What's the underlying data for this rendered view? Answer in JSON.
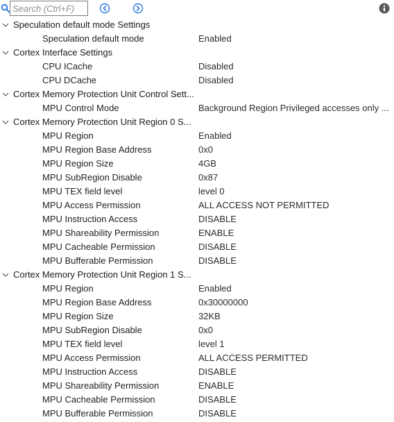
{
  "toolbar": {
    "search_placeholder": "Search (Ctrl+F)",
    "search_icon": "magnifier-icon",
    "back_icon": "circle-chevron-left-icon",
    "forward_icon": "circle-chevron-right-icon",
    "info_icon": "info-icon",
    "accent_color": "#2b78e4"
  },
  "groups": [
    {
      "label": "Speculation default mode Settings",
      "params": [
        {
          "label": "Speculation default mode",
          "value": "Enabled"
        }
      ]
    },
    {
      "label": "Cortex Interface Settings",
      "params": [
        {
          "label": "CPU ICache",
          "value": "Disabled"
        },
        {
          "label": "CPU DCache",
          "value": "Disabled"
        }
      ]
    },
    {
      "label": "Cortex Memory Protection Unit Control Sett...",
      "params": [
        {
          "label": "MPU Control Mode",
          "value": "Background Region Privileged accesses only ..."
        }
      ]
    },
    {
      "label": "Cortex Memory Protection Unit Region 0 S...",
      "params": [
        {
          "label": "MPU Region",
          "value": "Enabled"
        },
        {
          "label": "MPU Region Base Address",
          "value": "0x0"
        },
        {
          "label": "MPU Region Size",
          "value": "4GB"
        },
        {
          "label": "MPU SubRegion Disable",
          "value": "0x87"
        },
        {
          "label": "MPU TEX field level",
          "value": "level 0"
        },
        {
          "label": "MPU Access Permission",
          "value": "ALL ACCESS NOT PERMITTED"
        },
        {
          "label": "MPU Instruction Access",
          "value": "DISABLE"
        },
        {
          "label": "MPU Shareability Permission",
          "value": "ENABLE"
        },
        {
          "label": "MPU Cacheable Permission",
          "value": "DISABLE"
        },
        {
          "label": "MPU Bufferable  Permission",
          "value": "DISABLE"
        }
      ]
    },
    {
      "label": "Cortex Memory Protection Unit Region 1 S...",
      "params": [
        {
          "label": "MPU Region",
          "value": "Enabled"
        },
        {
          "label": "MPU Region Base Address",
          "value": "0x30000000"
        },
        {
          "label": "MPU Region Size",
          "value": "32KB"
        },
        {
          "label": "MPU SubRegion Disable",
          "value": "0x0"
        },
        {
          "label": "MPU TEX field level",
          "value": "level 1"
        },
        {
          "label": "MPU Access Permission",
          "value": "ALL ACCESS PERMITTED"
        },
        {
          "label": "MPU Instruction Access",
          "value": "DISABLE"
        },
        {
          "label": "MPU Shareability Permission",
          "value": "ENABLE"
        },
        {
          "label": "MPU Cacheable Permission",
          "value": "DISABLE"
        },
        {
          "label": "MPU Bufferable  Permission",
          "value": "DISABLE"
        }
      ]
    }
  ]
}
